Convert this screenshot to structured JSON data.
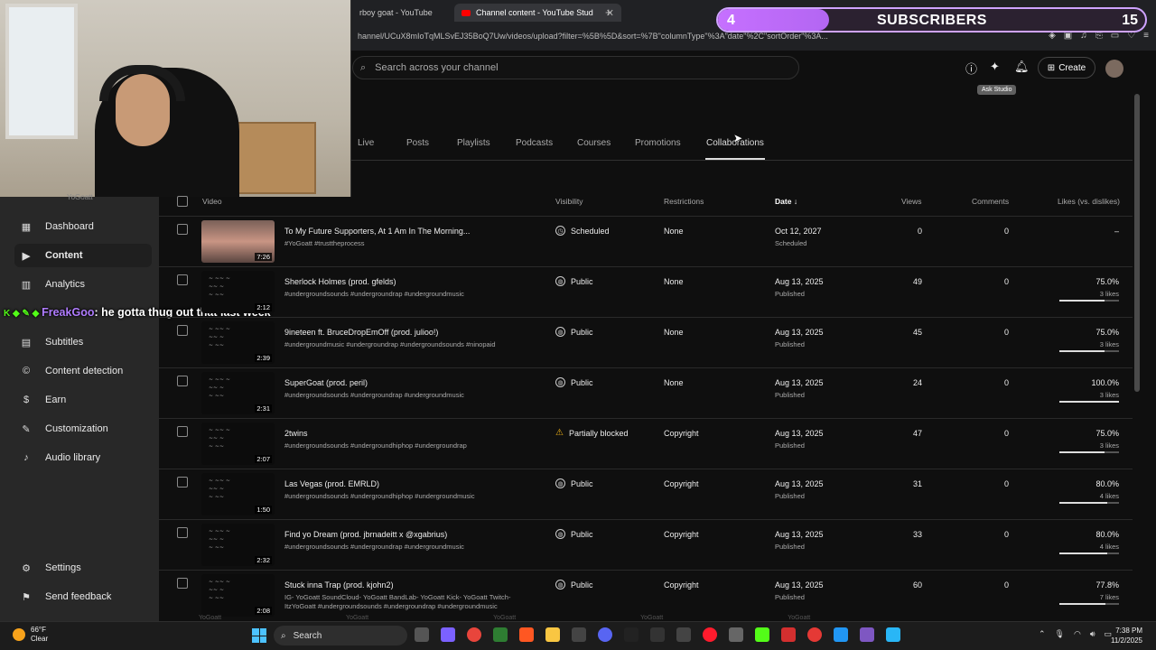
{
  "browser": {
    "tabs": [
      {
        "label": "rboy goat - YouTube"
      },
      {
        "label": "Channel content - YouTube Stud"
      }
    ],
    "url": "hannel/UCuX8mIoTqMLSvEJ35BoQ7Uw/videos/upload?filter=%5B%5D&sort=%7B\"columnType\"%3A\"date\"%2C\"sortOrder\"%3A..."
  },
  "overlay": {
    "sub_count": "4",
    "sub_label": "SUBSCRIBERS",
    "sub_goal": "15",
    "sub_progress": 0.26
  },
  "chat": {
    "username": "FreakGoo",
    "message": ": he gotta thug out that last week"
  },
  "header": {
    "search_placeholder": "Search across your channel",
    "create_label": "Create",
    "tooltip": "Ask Studio"
  },
  "sidebar": {
    "channel_name": "YoGoatt",
    "items": [
      {
        "label": "Dashboard",
        "icon": "dashboard-icon"
      },
      {
        "label": "Content",
        "icon": "content-icon",
        "active": true
      },
      {
        "label": "Analytics",
        "icon": "analytics-icon"
      },
      {
        "label": "Subtitles",
        "icon": "subtitles-icon"
      },
      {
        "label": "Content detection",
        "icon": "copyright-icon"
      },
      {
        "label": "Earn",
        "icon": "earn-icon"
      },
      {
        "label": "Customization",
        "icon": "wand-icon"
      },
      {
        "label": "Audio library",
        "icon": "audio-icon"
      }
    ],
    "settings": "Settings",
    "feedback": "Send feedback"
  },
  "tabs": [
    "Live",
    "Posts",
    "Playlists",
    "Podcasts",
    "Courses",
    "Promotions",
    "Collaborations"
  ],
  "table": {
    "headers": {
      "video": "Video",
      "visibility": "Visibility",
      "restrictions": "Restrictions",
      "date": "Date",
      "views": "Views",
      "comments": "Comments",
      "likes": "Likes (vs. dislikes)"
    },
    "rows": [
      {
        "title": "To My Future Supporters, At 1 Am In The Morning...",
        "desc": "#YoGoatt #trusttheprocess",
        "duration": "7:26",
        "visibility": "Scheduled",
        "vis_icon": "clock-icon",
        "restrictions": "None",
        "date": "Oct 12, 2027",
        "date_status": "Scheduled",
        "views": "0",
        "comments": "0",
        "likes": "–",
        "likes_sub": "",
        "like_ratio": null,
        "face": true
      },
      {
        "title": "Sherlock Holmes (prod. gfelds)",
        "desc": "#undergroundsounds #undergroundrap #undergroundmusic",
        "duration": "2:12",
        "visibility": "Public",
        "vis_icon": "globe-icon",
        "restrictions": "None",
        "date": "Aug 13, 2025",
        "date_status": "Published",
        "views": "49",
        "comments": "0",
        "likes": "75.0%",
        "likes_sub": "3 likes",
        "like_ratio": 0.75
      },
      {
        "title": "9ineteen ft. BruceDropEmOff (prod. julioo!)",
        "desc": "#undergroundmusic #undergroundrap #undergroundsounds #ninopaid",
        "duration": "2:39",
        "visibility": "Public",
        "vis_icon": "globe-icon",
        "restrictions": "None",
        "date": "Aug 13, 2025",
        "date_status": "Published",
        "views": "45",
        "comments": "0",
        "likes": "75.0%",
        "likes_sub": "3 likes",
        "like_ratio": 0.75
      },
      {
        "title": "SuperGoat (prod. peril)",
        "desc": "#undergroundsounds #undergroundrap #undergroundmusic",
        "duration": "2:31",
        "visibility": "Public",
        "vis_icon": "globe-icon",
        "restrictions": "None",
        "date": "Aug 13, 2025",
        "date_status": "Published",
        "views": "24",
        "comments": "0",
        "likes": "100.0%",
        "likes_sub": "3 likes",
        "like_ratio": 1.0
      },
      {
        "title": "2twins",
        "desc": "#undergroundsounds #undergroundhiphop #undergroundrap",
        "duration": "2:07",
        "visibility": "Partially blocked",
        "vis_icon": "warning-icon",
        "restrictions": "Copyright",
        "date": "Aug 13, 2025",
        "date_status": "Published",
        "views": "47",
        "comments": "0",
        "likes": "75.0%",
        "likes_sub": "3 likes",
        "like_ratio": 0.75
      },
      {
        "title": "Las Vegas (prod. EMRLD)",
        "desc": "#undergroundsounds #undergroundhiphop #undergroundmusic",
        "duration": "1:50",
        "visibility": "Public",
        "vis_icon": "globe-icon",
        "restrictions": "Copyright",
        "date": "Aug 13, 2025",
        "date_status": "Published",
        "views": "31",
        "comments": "0",
        "likes": "80.0%",
        "likes_sub": "4 likes",
        "like_ratio": 0.8
      },
      {
        "title": "Find yo Dream (prod. jbrnadeitt x @xgabrius)",
        "desc": "#undergroundsounds #undergroundrap #undergroundmusic",
        "duration": "2:32",
        "visibility": "Public",
        "vis_icon": "globe-icon",
        "restrictions": "Copyright",
        "date": "Aug 13, 2025",
        "date_status": "Published",
        "views": "33",
        "comments": "0",
        "likes": "80.0%",
        "likes_sub": "4 likes",
        "like_ratio": 0.8
      },
      {
        "title": "Stuck inna Trap (prod. kjohn2)",
        "desc": "IG- YoGoatt SoundCloud- YoGoatt BandLab- YoGoatt Kick- YoGoatt Twitch-",
        "desc2": "ItzYoGoatt #undergroundsounds #undergroundrap #undergroundmusic",
        "duration": "2:08",
        "visibility": "Public",
        "vis_icon": "globe-icon",
        "restrictions": "Copyright",
        "date": "Aug 13, 2025",
        "date_status": "Published",
        "views": "60",
        "comments": "0",
        "likes": "77.8%",
        "likes_sub": "7 likes",
        "like_ratio": 0.778
      }
    ]
  },
  "taskbar": {
    "temp": "66°F",
    "weather": "Clear",
    "search": "Search",
    "time": "7:38 PM",
    "date": "11/2/2025"
  }
}
